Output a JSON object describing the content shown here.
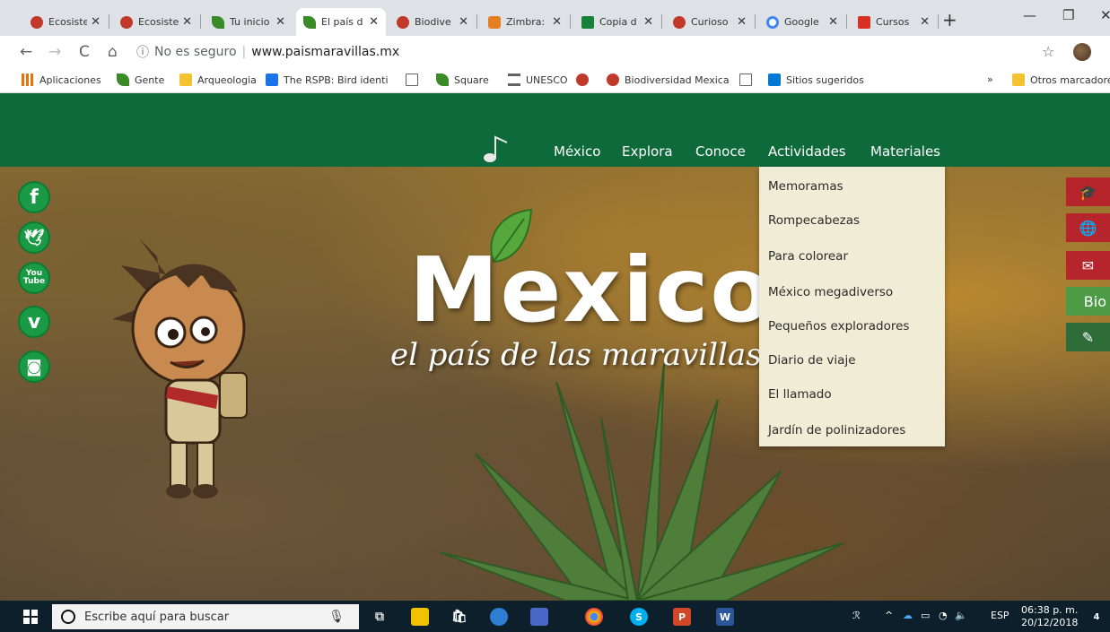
{
  "browser": {
    "tabs": [
      {
        "title": "Ecosiste",
        "favicon_color": "#c0392b"
      },
      {
        "title": "Ecosiste",
        "favicon_color": "#c0392b"
      },
      {
        "title": "Tu inicio",
        "favicon_color": "#3a8a2a"
      },
      {
        "title": "El país d",
        "favicon_color": "#3a8a2a",
        "active": true
      },
      {
        "title": "Biodive",
        "favicon_color": "#c0392b"
      },
      {
        "title": "Zimbra:",
        "favicon_color": "#e67e22"
      },
      {
        "title": "Copia d",
        "favicon_color": "#188038"
      },
      {
        "title": "Curioso",
        "favicon_color": "#c0392b"
      },
      {
        "title": "Google",
        "favicon_color": "#4285f4"
      },
      {
        "title": "Cursos",
        "favicon_color": "#d93025"
      }
    ],
    "tab_close": "✕",
    "new_tab": "+",
    "window_controls": {
      "minimize": "—",
      "restore": "❐",
      "close": "✕"
    },
    "nav": {
      "back": "←",
      "forward": "→",
      "reload": "C",
      "home": "⌂"
    },
    "address": {
      "security_icon": "ⓘ",
      "security_text": "No es seguro",
      "separator": "|",
      "url": "www.paismaravillas.mx"
    },
    "star": "☆",
    "menu": "⋮",
    "bookmarks": [
      {
        "label": "Aplicaciones",
        "icon": "apps-grid-icon",
        "color": "#e8710a"
      },
      {
        "label": "Gente",
        "icon": "leaf-icon",
        "color": "#3a8a2a"
      },
      {
        "label": "Arqueologia",
        "icon": "folder-icon",
        "color": "#f4c430"
      },
      {
        "label": "The RSPB: Bird identi",
        "icon": "rspb-icon",
        "color": "#1a73e8"
      },
      {
        "label": "",
        "icon": "page-icon",
        "color": "#5f6368"
      },
      {
        "label": "Square",
        "icon": "leaf-icon",
        "color": "#3a8a2a"
      },
      {
        "label": "UNESCO",
        "icon": "museum-icon",
        "color": "#5f6368"
      },
      {
        "label": "",
        "icon": "globe-icon",
        "color": "#c0392b"
      },
      {
        "label": "Biodiversidad Mexica",
        "icon": "globe-icon",
        "color": "#c0392b"
      },
      {
        "label": "",
        "icon": "page-icon",
        "color": "#5f6368"
      },
      {
        "label": "Sitios sugeridos",
        "icon": "bing-icon",
        "color": "#0078d4"
      }
    ],
    "bookmarks_overflow": "»",
    "other_bookmarks": "Otros marcadore"
  },
  "site": {
    "menu": [
      "México",
      "Explora",
      "Conoce",
      "Actividades",
      "Materiales"
    ],
    "hero_title": "Mexico",
    "hero_subtitle": "el país de las maravillas",
    "dropdown": [
      "Memoramas",
      "Rompecabezas",
      "Para colorear",
      "México megadiverso",
      "Pequeños exploradores",
      "Diario de viaje",
      "El llamado",
      "Jardín de polinizadores"
    ],
    "social": [
      {
        "label": "f",
        "icon": "facebook-icon"
      },
      {
        "label": "🕊",
        "icon": "twitter-icon"
      },
      {
        "label": "You Tube",
        "icon": "youtube-icon"
      },
      {
        "label": "v",
        "icon": "vimeo-icon"
      },
      {
        "label": "◙",
        "icon": "instagram-icon"
      }
    ],
    "side_tabs": [
      {
        "label": "🎓",
        "icon": "graduation-cap-icon",
        "color": "#b5252b"
      },
      {
        "label": "🌐",
        "icon": "globe-icon",
        "color": "#b5252b"
      },
      {
        "label": "✉",
        "icon": "envelope-icon",
        "color": "#b5252b"
      },
      {
        "label": "Bio",
        "icon": "bio-icon",
        "color": "#4d9a47"
      },
      {
        "label": "✎",
        "icon": "pencil-icon",
        "color": "#2e6d3a"
      }
    ],
    "colors": {
      "nav_green": "#0f6a3b",
      "dropdown_bg": "#f1ecd6"
    }
  },
  "taskbar": {
    "search_placeholder": "Escribe aquí para buscar",
    "mic": "🎙",
    "apps": [
      {
        "label": "⧉",
        "icon": "task-view-icon",
        "color": "#0c1f2a"
      },
      {
        "label": "",
        "icon": "file-explorer-icon",
        "color": "#f2c200"
      },
      {
        "label": "🛍",
        "icon": "store-icon",
        "color": "#0c1f2a"
      },
      {
        "label": "",
        "icon": "network-globe-icon",
        "color": "#2d7dd2"
      },
      {
        "label": "",
        "icon": "app-icon",
        "color": "#4a68c9"
      },
      {
        "label": "",
        "icon": "chrome-icon",
        "color": "#e8453c"
      },
      {
        "label": "S",
        "icon": "skype-icon",
        "color": "#00aff0"
      },
      {
        "label": "P",
        "icon": "powerpoint-icon",
        "color": "#d24726"
      },
      {
        "label": "W",
        "icon": "word-icon",
        "color": "#2b579a"
      }
    ],
    "tray": {
      "people": "ℛ",
      "chevron": "^",
      "cloud": "☁",
      "battery": "▭",
      "wifi": "◔",
      "volume": "🔈",
      "lang": "ESP"
    },
    "time": "06:38 p. m.",
    "date": "20/12/2018",
    "notifications": "4"
  }
}
